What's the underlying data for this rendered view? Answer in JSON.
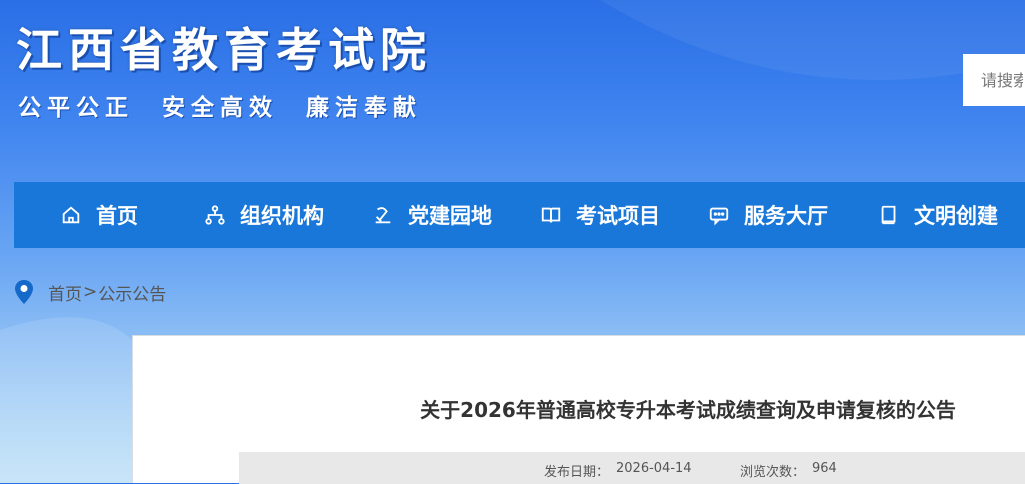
{
  "header": {
    "site_title": "江西省教育考试院",
    "slogan": "公平公正  安全高效  廉洁奉献",
    "search_placeholder": "请搜索"
  },
  "nav": {
    "items": [
      {
        "label": "首页",
        "icon": "home-icon"
      },
      {
        "label": "组织机构",
        "icon": "org-chart-icon"
      },
      {
        "label": "党建园地",
        "icon": "party-emblem-icon"
      },
      {
        "label": "考试项目",
        "icon": "open-book-icon"
      },
      {
        "label": "服务大厅",
        "icon": "chat-bubble-icon"
      },
      {
        "label": "文明创建",
        "icon": "book-icon"
      }
    ]
  },
  "breadcrumb": {
    "home": "首页",
    "separator": ">",
    "current": "公示公告",
    "icon": "location-pin-icon"
  },
  "article": {
    "title": "关于2026年普通高校专升本考试成绩查询及申请复核的公告",
    "date_label": "发布日期：",
    "date": "2026-04-14",
    "views_label": "浏览次数：",
    "views": "964"
  },
  "colors": {
    "nav_bg": "#1877d8",
    "header_blue": "#2a6fe6",
    "pin_blue": "#1469c9"
  }
}
